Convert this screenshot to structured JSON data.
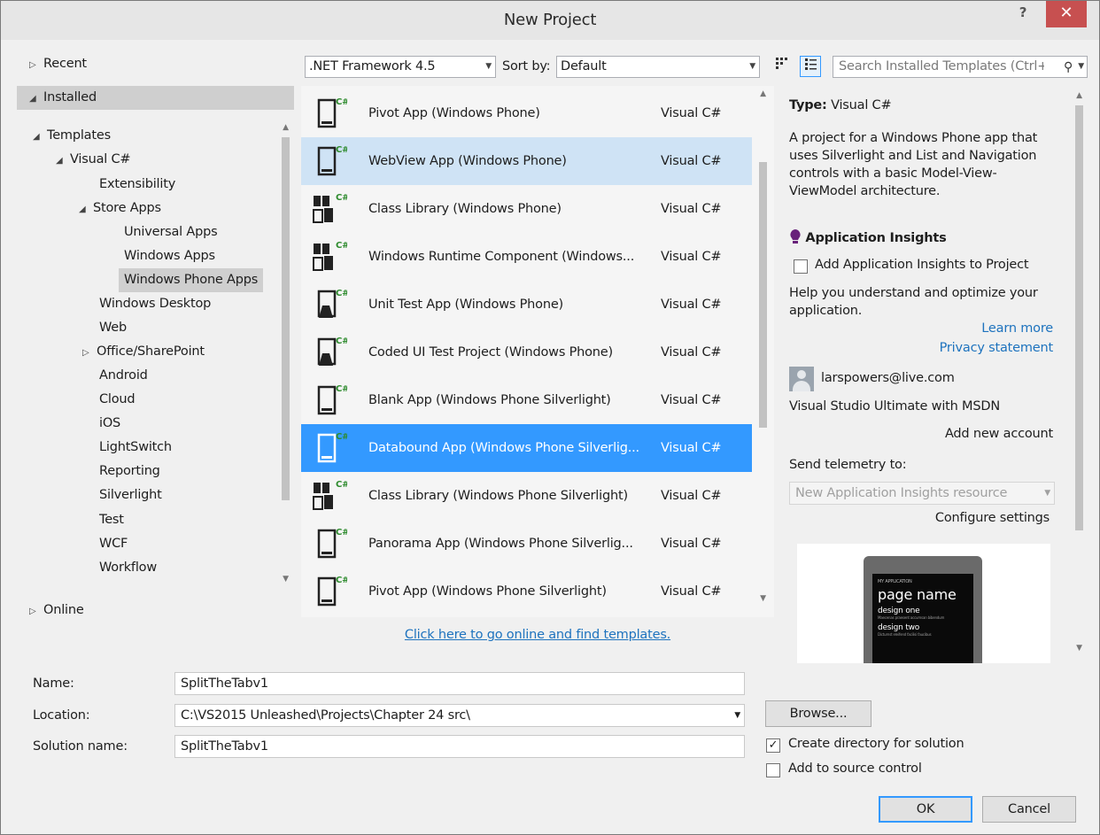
{
  "window": {
    "title": "New Project",
    "help": "?",
    "close": "✕"
  },
  "tree": {
    "recent": "Recent",
    "installed": "Installed",
    "templates": "Templates",
    "visual_csharp": "Visual C#",
    "extensibility": "Extensibility",
    "store_apps": "Store Apps",
    "universal_apps": "Universal Apps",
    "windows_apps": "Windows Apps",
    "windows_phone_apps": "Windows Phone Apps",
    "windows_desktop": "Windows Desktop",
    "web": "Web",
    "office_sharepoint": "Office/SharePoint",
    "android": "Android",
    "cloud": "Cloud",
    "ios": "iOS",
    "lightswitch": "LightSwitch",
    "reporting": "Reporting",
    "silverlight": "Silverlight",
    "test": "Test",
    "wcf": "WCF",
    "workflow": "Workflow",
    "online": "Online"
  },
  "toolbar": {
    "framework": ".NET Framework 4.5",
    "sort_label": "Sort by:",
    "sort_value": "Default",
    "search_placeholder": "Search Installed Templates (Ctrl+E)"
  },
  "templates": [
    {
      "name": "Pivot App (Windows Phone)",
      "lang": "Visual C#",
      "icon": "pivot-app-icon"
    },
    {
      "name": "WebView App (Windows Phone)",
      "lang": "Visual C#",
      "icon": "webview-app-icon"
    },
    {
      "name": "Class Library (Windows Phone)",
      "lang": "Visual C#",
      "icon": "class-library-icon"
    },
    {
      "name": "Windows Runtime Component (Windows...",
      "lang": "Visual C#",
      "icon": "runtime-component-icon"
    },
    {
      "name": "Unit Test App (Windows Phone)",
      "lang": "Visual C#",
      "icon": "unit-test-icon"
    },
    {
      "name": "Coded UI Test Project (Windows Phone)",
      "lang": "Visual C#",
      "icon": "coded-ui-test-icon"
    },
    {
      "name": "Blank App (Windows Phone Silverlight)",
      "lang": "Visual C#",
      "icon": "blank-app-icon"
    },
    {
      "name": "Databound App (Windows Phone Silverlig...",
      "lang": "Visual C#",
      "icon": "databound-app-icon"
    },
    {
      "name": "Class Library (Windows Phone Silverlight)",
      "lang": "Visual C#",
      "icon": "class-library-silverlight-icon"
    },
    {
      "name": "Panorama App (Windows Phone Silverlig...",
      "lang": "Visual C#",
      "icon": "panorama-app-icon"
    },
    {
      "name": "Pivot App (Windows Phone Silverlight)",
      "lang": "Visual C#",
      "icon": "pivot-app-silverlight-icon"
    }
  ],
  "online_link": "Click here to go online and find templates.",
  "details": {
    "type_label": "Type:",
    "type_value": "Visual C#",
    "description": "A project for a Windows Phone app that uses Silverlight and List and Navigation controls with a basic Model-View-ViewModel architecture.",
    "insights_title": "Application Insights",
    "insights_checkbox": "Add Application Insights to Project",
    "insights_help": "Help you understand and optimize your application.",
    "learn_more": "Learn more",
    "privacy": "Privacy statement",
    "account_email": "larspowers@live.com",
    "account_subscription": "Visual Studio Ultimate with MSDN",
    "add_account": "Add new account",
    "telemetry_label": "Send telemetry to:",
    "telemetry_value": "New Application Insights resource",
    "configure": "Configure settings",
    "preview": {
      "app_label": "MY APPLICATION",
      "page_name": "page name",
      "item1": "design one",
      "item1_sub": "Maecenas praesent accumsan bibendum",
      "item2": "design two",
      "item2_sub": "Dictumst eleifend facilisi faucibus"
    }
  },
  "form": {
    "name_label": "Name:",
    "name_value": "SplitTheTabv1",
    "location_label": "Location:",
    "location_value": "C:\\VS2015 Unleashed\\Projects\\Chapter 24 src\\",
    "solution_label": "Solution name:",
    "solution_value": "SplitTheTabv1",
    "browse": "Browse...",
    "create_dir": "Create directory for solution",
    "create_dir_checked": true,
    "source_control": "Add to source control",
    "source_control_checked": false,
    "ok": "OK",
    "cancel": "Cancel"
  },
  "colors": {
    "selection": "#3399ff",
    "hover": "#cfe3f5",
    "link": "#1e73be",
    "close": "#c75050",
    "insights": "#68217a"
  }
}
